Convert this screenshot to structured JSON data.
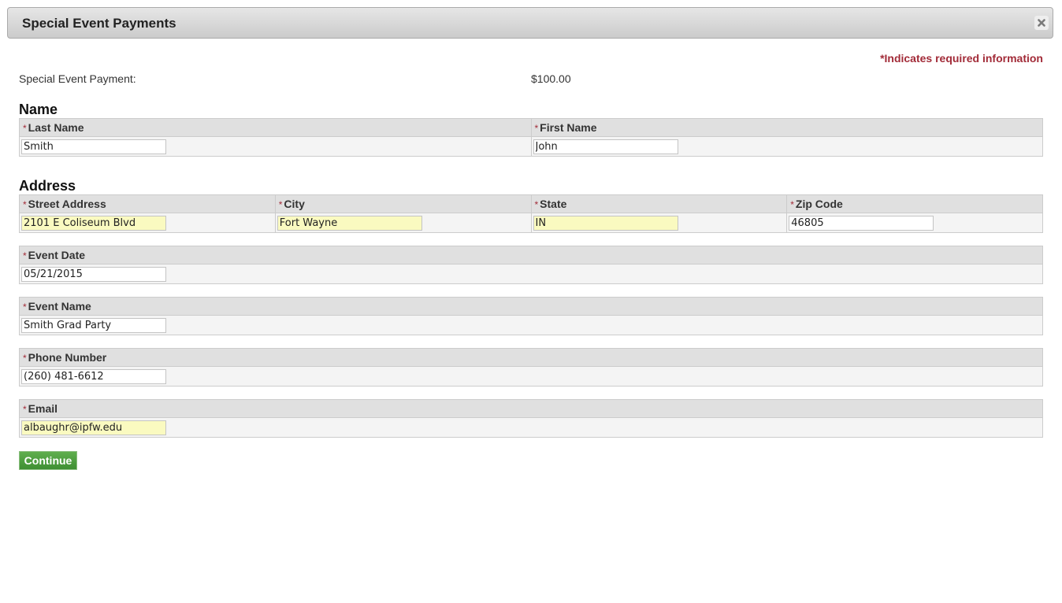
{
  "dialog": {
    "title": "Special Event Payments",
    "close_icon": "close-x-icon"
  },
  "required_note": "*Indicates required information",
  "payment": {
    "label": "Special Event Payment:",
    "amount": "$100.00"
  },
  "sections": {
    "name_heading": "Name",
    "address_heading": "Address"
  },
  "required_marker": "*",
  "fields": {
    "last_name": {
      "label": "Last Name",
      "value": "Smith"
    },
    "first_name": {
      "label": "First Name",
      "value": "John"
    },
    "street_address": {
      "label": "Street Address",
      "value": "2101 E Coliseum Blvd"
    },
    "city": {
      "label": "City",
      "value": "Fort Wayne"
    },
    "state": {
      "label": "State",
      "value": "IN"
    },
    "zip_code": {
      "label": "Zip Code",
      "value": "46805"
    },
    "event_date": {
      "label": "Event Date",
      "value": "05/21/2015"
    },
    "event_name": {
      "label": "Event Name",
      "value": "Smith Grad Party"
    },
    "phone_number": {
      "label": "Phone Number",
      "value": "(260) 481-6612"
    },
    "email": {
      "label": "Email",
      "value": "albaughr@ipfw.edu"
    }
  },
  "colors": {
    "required": "#a22b38",
    "autofill_bg": "#fafac0",
    "continue_green": "#4c9c3e"
  },
  "buttons": {
    "continue_label": "Continue"
  }
}
